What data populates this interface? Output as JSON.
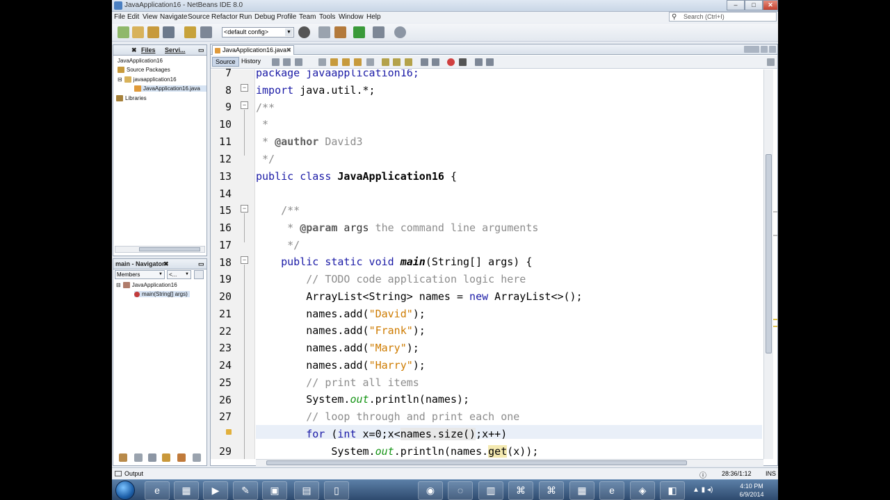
{
  "window": {
    "title": "JavaApplication16 - NetBeans IDE 8.0"
  },
  "menu": [
    "File",
    "Edit",
    "View",
    "Navigate",
    "Source",
    "Refactor",
    "Run",
    "Debug",
    "Profile",
    "Team",
    "Tools",
    "Window",
    "Help"
  ],
  "search": {
    "placeholder": "Search (Ctrl+I)"
  },
  "toolbar": {
    "config": "<default config>"
  },
  "projects_panel": {
    "tabs": [
      "Files",
      "Servi..."
    ],
    "tree": [
      "JavaApplication16",
      "Source Packages",
      "javaapplication16",
      "JavaApplication16.java",
      "Libraries"
    ]
  },
  "navigator_panel": {
    "title": "main - Navigator",
    "filter": "Members",
    "filter2": "<...",
    "tree": [
      "JavaApplication16",
      "main(String[] args)"
    ]
  },
  "editor": {
    "tab": "JavaApplication16.java",
    "source_label": "Source",
    "history_label": "History",
    "line_numbers": [
      "7",
      "8",
      "9",
      "10",
      "11",
      "12",
      "13",
      "14",
      "15",
      "16",
      "17",
      "18",
      "19",
      "20",
      "21",
      "22",
      "23",
      "24",
      "25",
      "26",
      "27",
      "28",
      "29"
    ]
  },
  "code": {
    "l7": "package javaapplication16;",
    "l8a": "import",
    "l8b": " java.util.*;",
    "l9": "/**",
    "l10": " *",
    "l11a": " * ",
    "l11b": "@author",
    "l11c": " David3",
    "l12": " */",
    "l13a": "public class ",
    "l13b": "JavaApplication16",
    "l13c": " {",
    "l15": "    /**",
    "l16a": "     * ",
    "l16b": "@param",
    "l16c": " args",
    "l16d": " the command line arguments",
    "l17": "     */",
    "l18a": "    public static void ",
    "l18b": "main",
    "l18c": "(String[] args) {",
    "l19": "        // TODO code application logic here",
    "l20a": "        ArrayList<String> names = ",
    "l20b": "new",
    "l20c": " ArrayList<>();",
    "l21a": "        names.add(",
    "l21b": "\"David\"",
    "l21c": ");",
    "l22a": "        names.add(",
    "l22b": "\"Frank\"",
    "l22c": ");",
    "l23a": "        names.add(",
    "l23b": "\"Mary\"",
    "l23c": ");",
    "l24a": "        names.add(",
    "l24b": "\"Harry\"",
    "l24c": ");",
    "l25": "        // print all items",
    "l26a": "        System.",
    "l26b": "out",
    "l26c": ".println(names);",
    "l27": "        // loop through and print each one",
    "l28a": "        ",
    "l28b": "for",
    "l28c": " (",
    "l28d": "int",
    "l28e": " x=0;x<",
    "l28f": "names.size()",
    "l28g": ";x++)",
    "l29a": "            System.",
    "l29b": "out",
    "l29c": ".println(names.",
    "l29d": "get",
    "l29e": "(x));"
  },
  "status": {
    "output": "Output",
    "position": "28:36/1:12",
    "mode": "INS"
  },
  "clock": {
    "time": "4:10 PM",
    "date": "6/9/2014"
  },
  "colors": {
    "keyword": "#1a1aa6",
    "string": "#ce7b00",
    "comment": "#8c8c8c",
    "field": "#149414"
  }
}
